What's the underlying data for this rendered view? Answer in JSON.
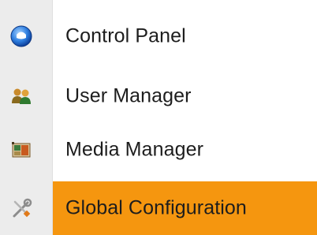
{
  "menu": {
    "items": [
      {
        "label": "Control Panel",
        "icon": "control-panel-icon",
        "active": false
      },
      {
        "label": "User Manager",
        "icon": "user-manager-icon",
        "active": false
      },
      {
        "label": "Media Manager",
        "icon": "media-manager-icon",
        "active": false
      },
      {
        "label": "Global Configuration",
        "icon": "global-configuration-icon",
        "active": true
      }
    ]
  },
  "colors": {
    "highlight": "#f5960f",
    "gutter": "#ececec",
    "text": "#1d1d1d"
  }
}
